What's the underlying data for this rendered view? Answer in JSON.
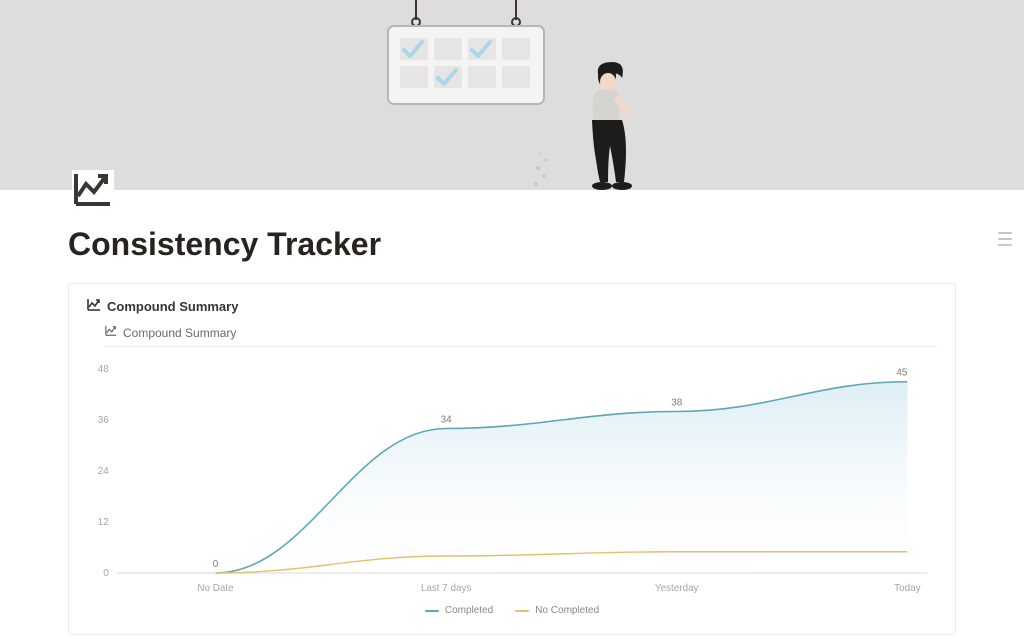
{
  "page": {
    "title": "Consistency Tracker"
  },
  "card": {
    "header": "Compound Summary",
    "tab": "Compound Summary"
  },
  "legend": {
    "completed": "Completed",
    "no_completed": "No Completed"
  },
  "chart_data": {
    "type": "area",
    "categories": [
      "No Date",
      "Last 7 days",
      "Yesterday",
      "Today"
    ],
    "series": [
      {
        "name": "Completed",
        "values": [
          0,
          34,
          38,
          45
        ],
        "color": "#5fa6b5"
      },
      {
        "name": "No Completed",
        "values": [
          0,
          4,
          5,
          5
        ],
        "color": "#e0c467"
      }
    ],
    "yticks": [
      0,
      12,
      24,
      36,
      48
    ],
    "ylim": [
      0,
      48
    ],
    "data_labels": [
      0,
      34,
      38,
      45
    ],
    "colors": {
      "completed_line": "#5fa6b5",
      "completed_fill_top": "#d8ecf4",
      "completed_fill_bottom": "#fdfefe",
      "no_completed_line": "#e0c467"
    }
  }
}
